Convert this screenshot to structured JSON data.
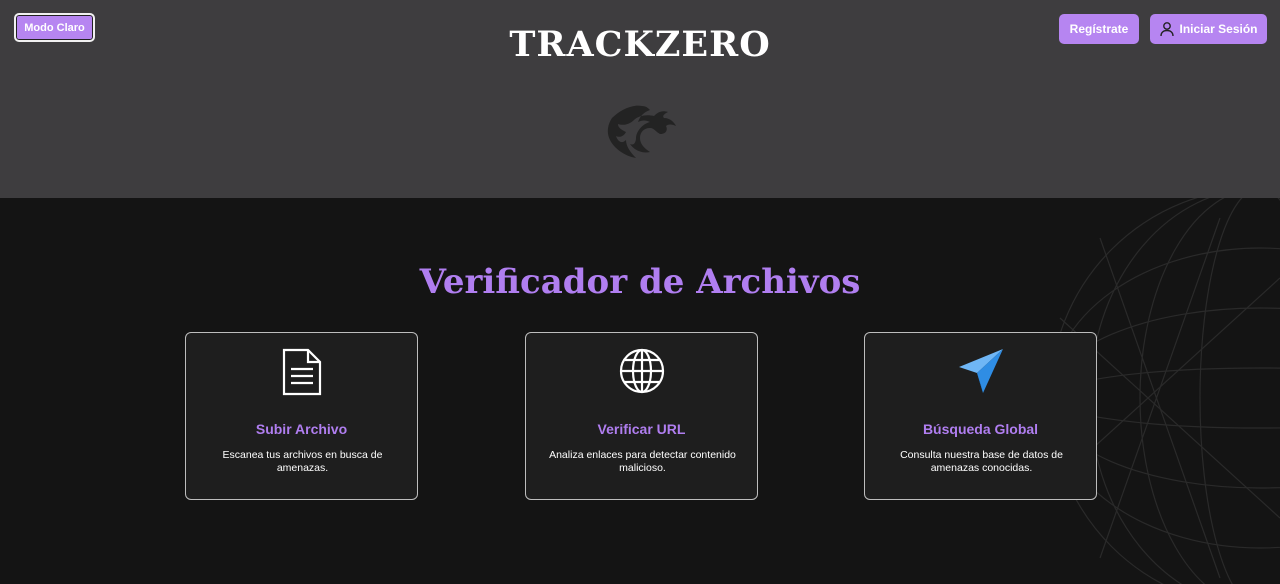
{
  "header": {
    "mode_button": "Modo Claro",
    "brand": "TRACKZERO",
    "register_button": "Regístrate",
    "login_button": "Iniciar Sesión"
  },
  "main": {
    "title": "Verificador de Archivos",
    "cards": [
      {
        "icon": "document-icon",
        "title": "Subir Archivo",
        "description": "Escanea tus archivos en busca de amenazas."
      },
      {
        "icon": "globe-icon",
        "title": "Verificar URL",
        "description": "Analiza enlaces para detectar contenido malicioso."
      },
      {
        "icon": "paper-plane-icon",
        "title": "Búsqueda Global",
        "description": "Consulta nuestra base de datos de amenazas conocidas."
      }
    ]
  },
  "colors": {
    "accent": "#b685f1",
    "header_bg": "#3e3d3f",
    "page_bg": "#141414",
    "card_border": "#bdbdbd"
  }
}
